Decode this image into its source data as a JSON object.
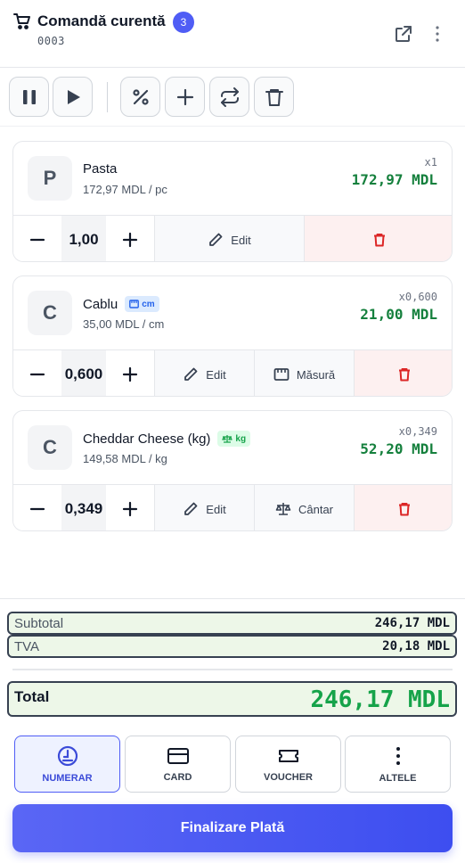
{
  "header": {
    "title": "Comandă curentă",
    "item_count": "3",
    "order_number": "0003",
    "icons": [
      "cart-icon",
      "open-external-icon",
      "more-vertical-icon"
    ]
  },
  "toolbar": {
    "buttons": [
      "pause-icon",
      "play-icon",
      "percent-icon",
      "plus-icon",
      "swap-icon",
      "trash-icon"
    ]
  },
  "items": [
    {
      "initial": "P",
      "name": "Pasta",
      "unit_price": "172,97 MDL / pc",
      "qty_label": "x1",
      "total": "172,97 MDL",
      "qty": "1,00",
      "edit_label": "Edit"
    },
    {
      "initial": "C",
      "name": "Cablu",
      "unit_badge": "cm",
      "unit_price": "35,00 MDL / cm",
      "qty_label": "x0,600",
      "total": "21,00 MDL",
      "qty": "0,600",
      "edit_label": "Edit",
      "extra_label": "Măsură"
    },
    {
      "initial": "C",
      "name": "Cheddar Cheese (kg)",
      "unit_badge": "kg",
      "unit_price": "149,58 MDL / kg",
      "qty_label": "x0,349",
      "total": "52,20 MDL",
      "qty": "0,349",
      "edit_label": "Edit",
      "extra_label": "Cântar"
    }
  ],
  "totals": {
    "subtotal_label": "Subtotal",
    "subtotal_value": "246,17 MDL",
    "tva_label": "TVA",
    "tva_value": "20,18 MDL",
    "total_label": "Total",
    "total_value": "246,17 MDL"
  },
  "payment_methods": [
    {
      "label": "NUMERAR",
      "icon": "cash-icon",
      "active": true
    },
    {
      "label": "CARD",
      "icon": "card-icon",
      "active": false
    },
    {
      "label": "VOUCHER",
      "icon": "voucher-icon",
      "active": false
    },
    {
      "label": "ALTELE",
      "icon": "more-vertical-icon",
      "active": false
    }
  ],
  "finalize_label": "Finalizare Plată",
  "colors": {
    "accent": "#4f5df5",
    "price_green": "#15803d",
    "total_green": "#16a34a",
    "delete_red": "#dc2626",
    "totals_bg": "#edf7e8"
  }
}
